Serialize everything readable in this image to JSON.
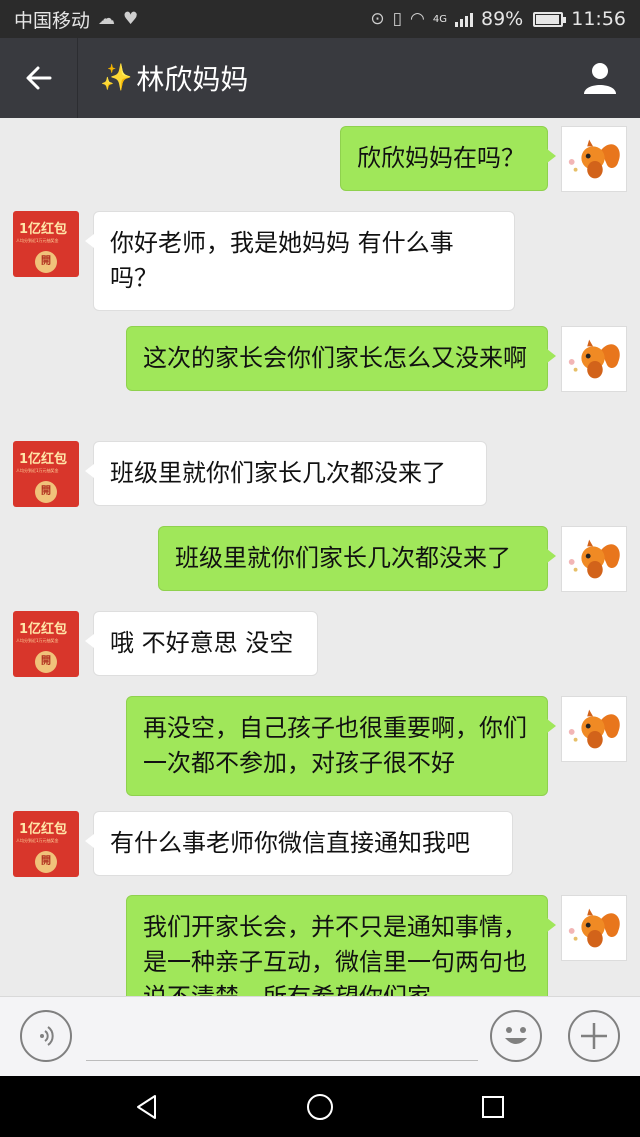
{
  "status_bar": {
    "carrier": "中国移动",
    "network_type": "4G",
    "battery": "89%",
    "battery_level": 0.89,
    "time": "11:56"
  },
  "header": {
    "emoji": "✨",
    "title": "林欣妈妈"
  },
  "redpacket_avatar": {
    "title": "1亿红包",
    "subtitle": "人均分到近1万元抽奖金",
    "coin": "開"
  },
  "messages": [
    {
      "side": "right",
      "text": "欣欣妈妈在吗？"
    },
    {
      "side": "left",
      "text": "你好老师，我是她妈妈  有什么事吗？"
    },
    {
      "side": "right",
      "text": "这次的家长会你们家长怎么又没来啊"
    },
    {
      "side": "left",
      "text": "班级里就你们家长几次都没来了"
    },
    {
      "side": "right",
      "text": "班级里就你们家长几次都没来了"
    },
    {
      "side": "left",
      "text": "哦 不好意思 没空"
    },
    {
      "side": "right",
      "text": "再没空，自己孩子也很重要啊，你们一次都不参加，对孩子很不好"
    },
    {
      "side": "left",
      "text": "有什么事老师你微信直接通知我吧"
    },
    {
      "side": "right",
      "text": "我们开家长会，并不只是通知事情，是一种亲子互动，微信里一句两句也说不清楚，所有希望你们家"
    }
  ],
  "input_bar": {
    "text_value": ""
  },
  "icons": {
    "back": "arrow-left-icon",
    "profile": "person-icon",
    "voice": "voice-icon",
    "emoji": "smiley-icon",
    "plus": "plus-icon",
    "nav_back": "triangle-back-icon",
    "nav_home": "circle-home-icon",
    "nav_recent": "square-recent-icon"
  },
  "colors": {
    "sent_bubble": "#a0e75a",
    "received_bubble": "#ffffff",
    "nav_bar": "#393a3f",
    "background": "#ebebeb"
  }
}
